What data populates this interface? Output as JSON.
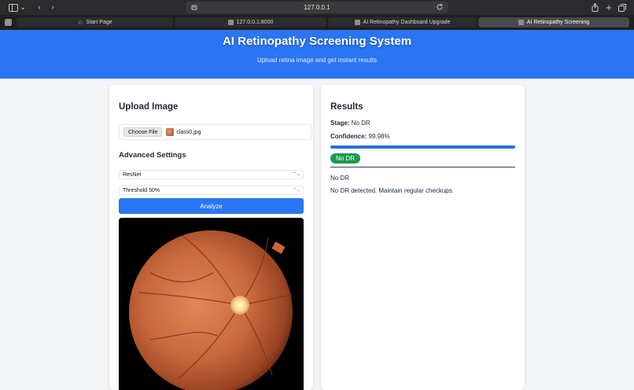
{
  "browser": {
    "url": "127.0.0.1",
    "tabs": [
      {
        "label": "Start Page",
        "active": false
      },
      {
        "label": "127.0.0.1:8000",
        "active": false
      },
      {
        "label": "AI Retinopathy Dashboard Upgrade",
        "active": false
      },
      {
        "label": "AI Retinopathy Screening",
        "active": true
      }
    ]
  },
  "header": {
    "title": "AI Retinopathy Screening System",
    "subtitle": "Upload retina image and get instant results"
  },
  "upload": {
    "heading": "Upload Image",
    "choose_file_label": "Choose File",
    "file_name": "class0.jpg",
    "advanced_heading": "Advanced Settings",
    "model_select": "ResNet",
    "threshold_select": "Threshold 50%",
    "analyze_label": "Analyze"
  },
  "results": {
    "heading": "Results",
    "stage_label": "Stage:",
    "stage_value": "No DR",
    "confidence_label": "Confidence:",
    "confidence_value": "99.98%",
    "confidence_fraction": 0.9998,
    "badge": "No DR",
    "summary": "No DR",
    "recommendation": "No DR detected. Maintain regular checkups."
  },
  "colors": {
    "accent": "#2a75f3",
    "badge_green": "#1a9b4b"
  }
}
